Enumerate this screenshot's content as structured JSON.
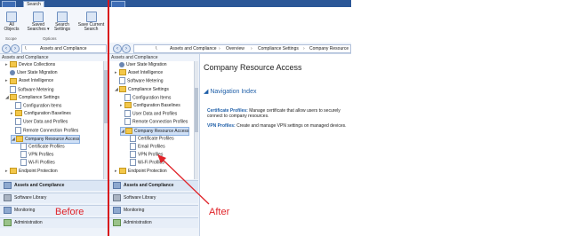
{
  "left": {
    "tab_label": "Search",
    "ribbon": {
      "buttons": [
        {
          "label1": "All",
          "label2": "Objects"
        },
        {
          "label1": "Saved",
          "label2": "Searches ▾"
        },
        {
          "label1": "Search",
          "label2": "Settings"
        },
        {
          "label1": "Save Current",
          "label2": "Search"
        }
      ],
      "groups": [
        "Scope",
        "Options"
      ]
    },
    "crumbs": [
      "\\",
      "Assets and Compliance"
    ],
    "pane_title": "Assets and Compliance",
    "tree": [
      {
        "label": "Device Collections",
        "icon": "folder",
        "exp": "▸",
        "indent": 0
      },
      {
        "label": "User State Migration",
        "icon": "gear",
        "exp": "",
        "indent": 0
      },
      {
        "label": "Asset Intelligence",
        "icon": "folder",
        "exp": "▸",
        "indent": 0
      },
      {
        "label": "Software Metering",
        "icon": "doc",
        "exp": "",
        "indent": 0
      },
      {
        "label": "Compliance Settings",
        "icon": "folder",
        "exp": "◢",
        "indent": 0
      },
      {
        "label": "Configuration Items",
        "icon": "doc",
        "exp": "",
        "indent": 1
      },
      {
        "label": "Configuration Baselines",
        "icon": "folder",
        "exp": "▸",
        "indent": 1
      },
      {
        "label": "User Data and Profiles",
        "icon": "doc",
        "exp": "",
        "indent": 1
      },
      {
        "label": "Remote Connection Profiles",
        "icon": "doc",
        "exp": "",
        "indent": 1
      },
      {
        "label": "Company Resource Access",
        "icon": "folder",
        "exp": "◢",
        "indent": 1,
        "sel": true
      },
      {
        "label": "Certificate Profiles",
        "icon": "doc",
        "exp": "",
        "indent": 2
      },
      {
        "label": "VPN Profiles",
        "icon": "doc",
        "exp": "",
        "indent": 2
      },
      {
        "label": "Wi-Fi Profiles",
        "icon": "doc",
        "exp": "",
        "indent": 2
      },
      {
        "label": "Endpoint Protection",
        "icon": "folder",
        "exp": "▸",
        "indent": 0
      }
    ],
    "workspaces": [
      {
        "label": "Assets and Compliance",
        "active": true,
        "icon": "blue"
      },
      {
        "label": "Software Library",
        "active": false,
        "icon": "gray"
      },
      {
        "label": "Monitoring",
        "active": false,
        "icon": "blue"
      },
      {
        "label": "Administration",
        "active": false,
        "icon": "green"
      }
    ],
    "annotation": "Before"
  },
  "right": {
    "crumbs": [
      "\\",
      "Assets and Compliance",
      "Overview",
      "Compliance Settings",
      "Company Resource"
    ],
    "pane_title": "Assets and Compliance",
    "tree": [
      {
        "label": "User State Migration",
        "icon": "gear",
        "exp": "",
        "indent": 0
      },
      {
        "label": "Asset Intelligence",
        "icon": "folder",
        "exp": "▸",
        "indent": 0
      },
      {
        "label": "Software Metering",
        "icon": "doc",
        "exp": "",
        "indent": 0
      },
      {
        "label": "Compliance Settings",
        "icon": "folder",
        "exp": "◢",
        "indent": 0
      },
      {
        "label": "Configuration Items",
        "icon": "doc",
        "exp": "",
        "indent": 1
      },
      {
        "label": "Configuration Baselines",
        "icon": "folder",
        "exp": "▸",
        "indent": 1
      },
      {
        "label": "User Data and Profiles",
        "icon": "doc",
        "exp": "",
        "indent": 1
      },
      {
        "label": "Remote Connection Profiles",
        "icon": "doc",
        "exp": "",
        "indent": 1
      },
      {
        "label": "Company Resource Access",
        "icon": "folder",
        "exp": "◢",
        "indent": 1,
        "sel": true
      },
      {
        "label": "Certificate Profiles",
        "icon": "doc",
        "exp": "",
        "indent": 2
      },
      {
        "label": "Email Profiles",
        "icon": "doc",
        "exp": "",
        "indent": 2
      },
      {
        "label": "VPN Profiles",
        "icon": "doc",
        "exp": "",
        "indent": 2
      },
      {
        "label": "Wi-Fi Profiles",
        "icon": "doc",
        "exp": "",
        "indent": 2
      },
      {
        "label": "Endpoint Protection",
        "icon": "folder",
        "exp": "▸",
        "indent": 0
      }
    ],
    "workspaces": [
      {
        "label": "Assets and Compliance",
        "active": true,
        "icon": "blue"
      },
      {
        "label": "Software Library",
        "active": false,
        "icon": "gray"
      },
      {
        "label": "Monitoring",
        "active": false,
        "icon": "blue"
      },
      {
        "label": "Administration",
        "active": false,
        "icon": "green"
      }
    ],
    "content": {
      "title": "Company Resource Access",
      "section": "Navigation Index",
      "items": [
        {
          "link": "Certificate Profiles:",
          "text": " Manage certificate that allow users to securely connect to company resources."
        },
        {
          "link": "VPN Profiles:",
          "text": " Create and manage VPN settings on managed devices."
        }
      ]
    },
    "annotation": "After"
  },
  "colors": {
    "accent": "#2b5797",
    "annotation": "#e0242a",
    "selection": "#cfe0f7"
  }
}
